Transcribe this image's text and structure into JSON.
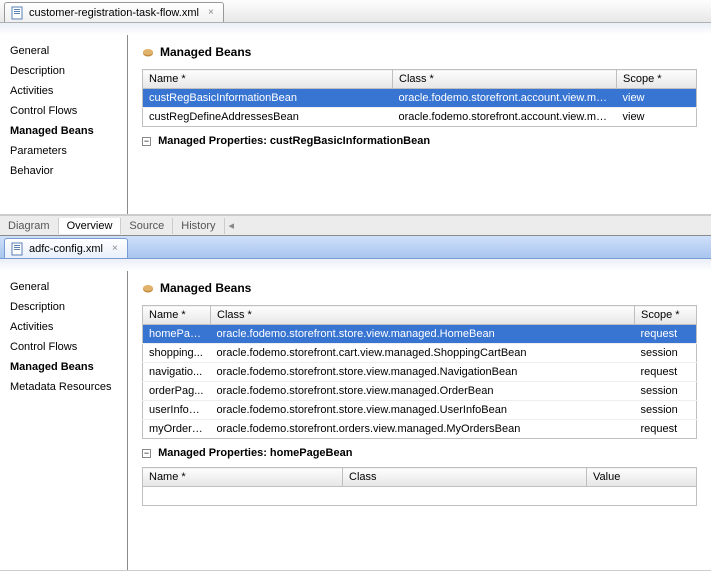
{
  "panel1": {
    "tab_filename": "customer-registration-task-flow.xml",
    "sidebar": [
      "General",
      "Description",
      "Activities",
      "Control Flows",
      "Managed Beans",
      "Parameters",
      "Behavior"
    ],
    "sidebar_selected": "Managed Beans",
    "section_title": "Managed Beans",
    "columns": {
      "name": "Name *",
      "class": "Class *",
      "scope": "Scope *"
    },
    "rows": [
      {
        "name": "custRegBasicInformationBean",
        "class": "oracle.fodemo.storefront.account.view.managed....",
        "scope": "view",
        "sel": true
      },
      {
        "name": "custRegDefineAddressesBean",
        "class": "oracle.fodemo.storefront.account.view.managed....",
        "scope": "view",
        "sel": false
      }
    ],
    "subsection": "Managed Properties: custRegBasicInformationBean",
    "bottom_tabs": [
      "Diagram",
      "Overview",
      "Source",
      "History"
    ],
    "bottom_active": "Overview"
  },
  "panel2": {
    "tab_filename": "adfc-config.xml",
    "sidebar": [
      "General",
      "Description",
      "Activities",
      "Control Flows",
      "Managed Beans",
      "Metadata Resources"
    ],
    "sidebar_selected": "Managed Beans",
    "section_title": "Managed Beans",
    "columns": {
      "name": "Name *",
      "class": "Class *",
      "scope": "Scope *"
    },
    "rows": [
      {
        "name": "homePag...",
        "class": "oracle.fodemo.storefront.store.view.managed.HomeBean",
        "scope": "request",
        "sel": true
      },
      {
        "name": "shopping...",
        "class": "oracle.fodemo.storefront.cart.view.managed.ShoppingCartBean",
        "scope": "session",
        "sel": false
      },
      {
        "name": "navigatio...",
        "class": "oracle.fodemo.storefront.store.view.managed.NavigationBean",
        "scope": "request",
        "sel": false
      },
      {
        "name": "orderPag...",
        "class": "oracle.fodemo.storefront.store.view.managed.OrderBean",
        "scope": "session",
        "sel": false
      },
      {
        "name": "userInfoB...",
        "class": "oracle.fodemo.storefront.store.view.managed.UserInfoBean",
        "scope": "session",
        "sel": false
      },
      {
        "name": "myOrders...",
        "class": "oracle.fodemo.storefront.orders.view.managed.MyOrdersBean",
        "scope": "request",
        "sel": false
      }
    ],
    "subsection": "Managed Properties: homePageBean",
    "props_columns": {
      "name": "Name *",
      "class": "Class",
      "value": "Value"
    }
  },
  "chart_data": {
    "type": "table",
    "tables": [
      {
        "title": "customer-registration-task-flow.xml — Managed Beans",
        "columns": [
          "Name",
          "Class",
          "Scope"
        ],
        "rows": [
          [
            "custRegBasicInformationBean",
            "oracle.fodemo.storefront.account.view.managed....",
            "view"
          ],
          [
            "custRegDefineAddressesBean",
            "oracle.fodemo.storefront.account.view.managed....",
            "view"
          ]
        ]
      },
      {
        "title": "adfc-config.xml — Managed Beans",
        "columns": [
          "Name",
          "Class",
          "Scope"
        ],
        "rows": [
          [
            "homePag...",
            "oracle.fodemo.storefront.store.view.managed.HomeBean",
            "request"
          ],
          [
            "shopping...",
            "oracle.fodemo.storefront.cart.view.managed.ShoppingCartBean",
            "session"
          ],
          [
            "navigatio...",
            "oracle.fodemo.storefront.store.view.managed.NavigationBean",
            "request"
          ],
          [
            "orderPag...",
            "oracle.fodemo.storefront.store.view.managed.OrderBean",
            "session"
          ],
          [
            "userInfoB...",
            "oracle.fodemo.storefront.store.view.managed.UserInfoBean",
            "session"
          ],
          [
            "myOrders...",
            "oracle.fodemo.storefront.orders.view.managed.MyOrdersBean",
            "request"
          ]
        ]
      }
    ]
  }
}
